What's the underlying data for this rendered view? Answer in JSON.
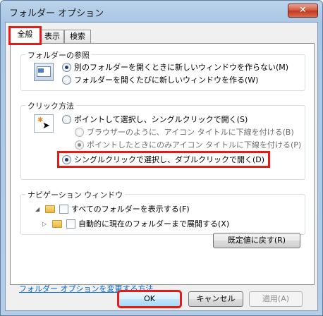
{
  "window": {
    "title": "フォルダー オプション",
    "close_glyph": "✕"
  },
  "tabs": [
    {
      "label": "全般",
      "active": true
    },
    {
      "label": "表示",
      "active": false
    },
    {
      "label": "検索",
      "active": false
    }
  ],
  "browse_group": {
    "label": "フォルダーの参照",
    "options": [
      {
        "label": "別のフォルダーを開くときに新しいウィンドウを作らない(M)",
        "selected": true
      },
      {
        "label": "フォルダーを開くたびに新しいウィンドウを作る(W)",
        "selected": false
      }
    ]
  },
  "click_group": {
    "label": "クリック方法",
    "options": [
      {
        "label": "ポイントして選択し、シングルクリックで開く(S)",
        "selected": false
      },
      {
        "label": "ブラウザーのように、アイコン タイトルに下線を付ける(B)",
        "selected": false,
        "disabled": true
      },
      {
        "label": "ポイントしたときにのみアイコン タイトルに下線を付ける(P)",
        "selected": true,
        "disabled": true
      },
      {
        "label": "シングルクリックで選択し、ダブルクリックで開く(D)",
        "selected": true
      }
    ]
  },
  "nav_group": {
    "label": "ナビゲーション ウィンドウ",
    "options": [
      {
        "label": "すべてのフォルダーを表示する(F)",
        "checked": false
      },
      {
        "label": "自動的に現在のフォルダーまで展開する(X)",
        "checked": false
      }
    ]
  },
  "restore_button": "既定値に戻す(R)",
  "help_link": "フォルダー オプションを変更する方法",
  "footer": {
    "ok": "OK",
    "cancel": "キャンセル",
    "apply": "適用(A)"
  },
  "colors": {
    "highlight": "#e41b17",
    "link": "#0066cc"
  }
}
